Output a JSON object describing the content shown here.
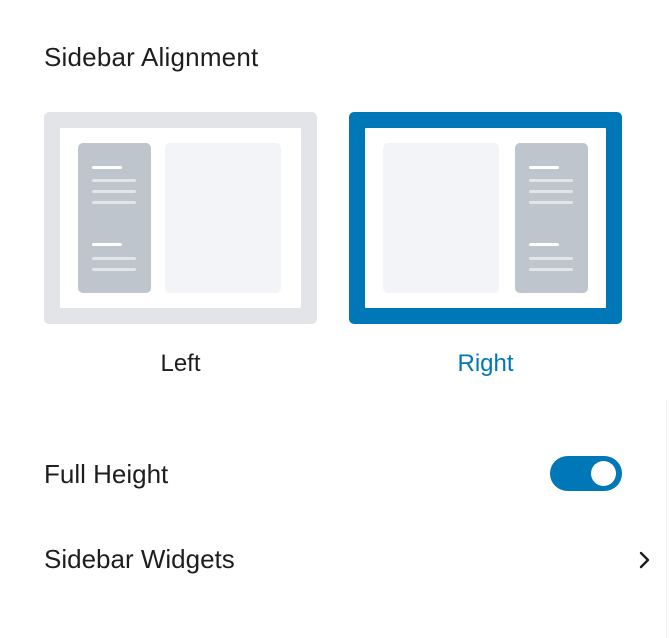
{
  "panel": {
    "title": "Sidebar Alignment",
    "options": [
      {
        "label": "Left",
        "selected": false
      },
      {
        "label": "Right",
        "selected": true
      }
    ],
    "accent_color": "#0077b6",
    "full_height": {
      "label": "Full Height",
      "enabled": true
    },
    "sidebar_widgets": {
      "label": "Sidebar Widgets",
      "icon": "chevron-right-icon"
    }
  }
}
